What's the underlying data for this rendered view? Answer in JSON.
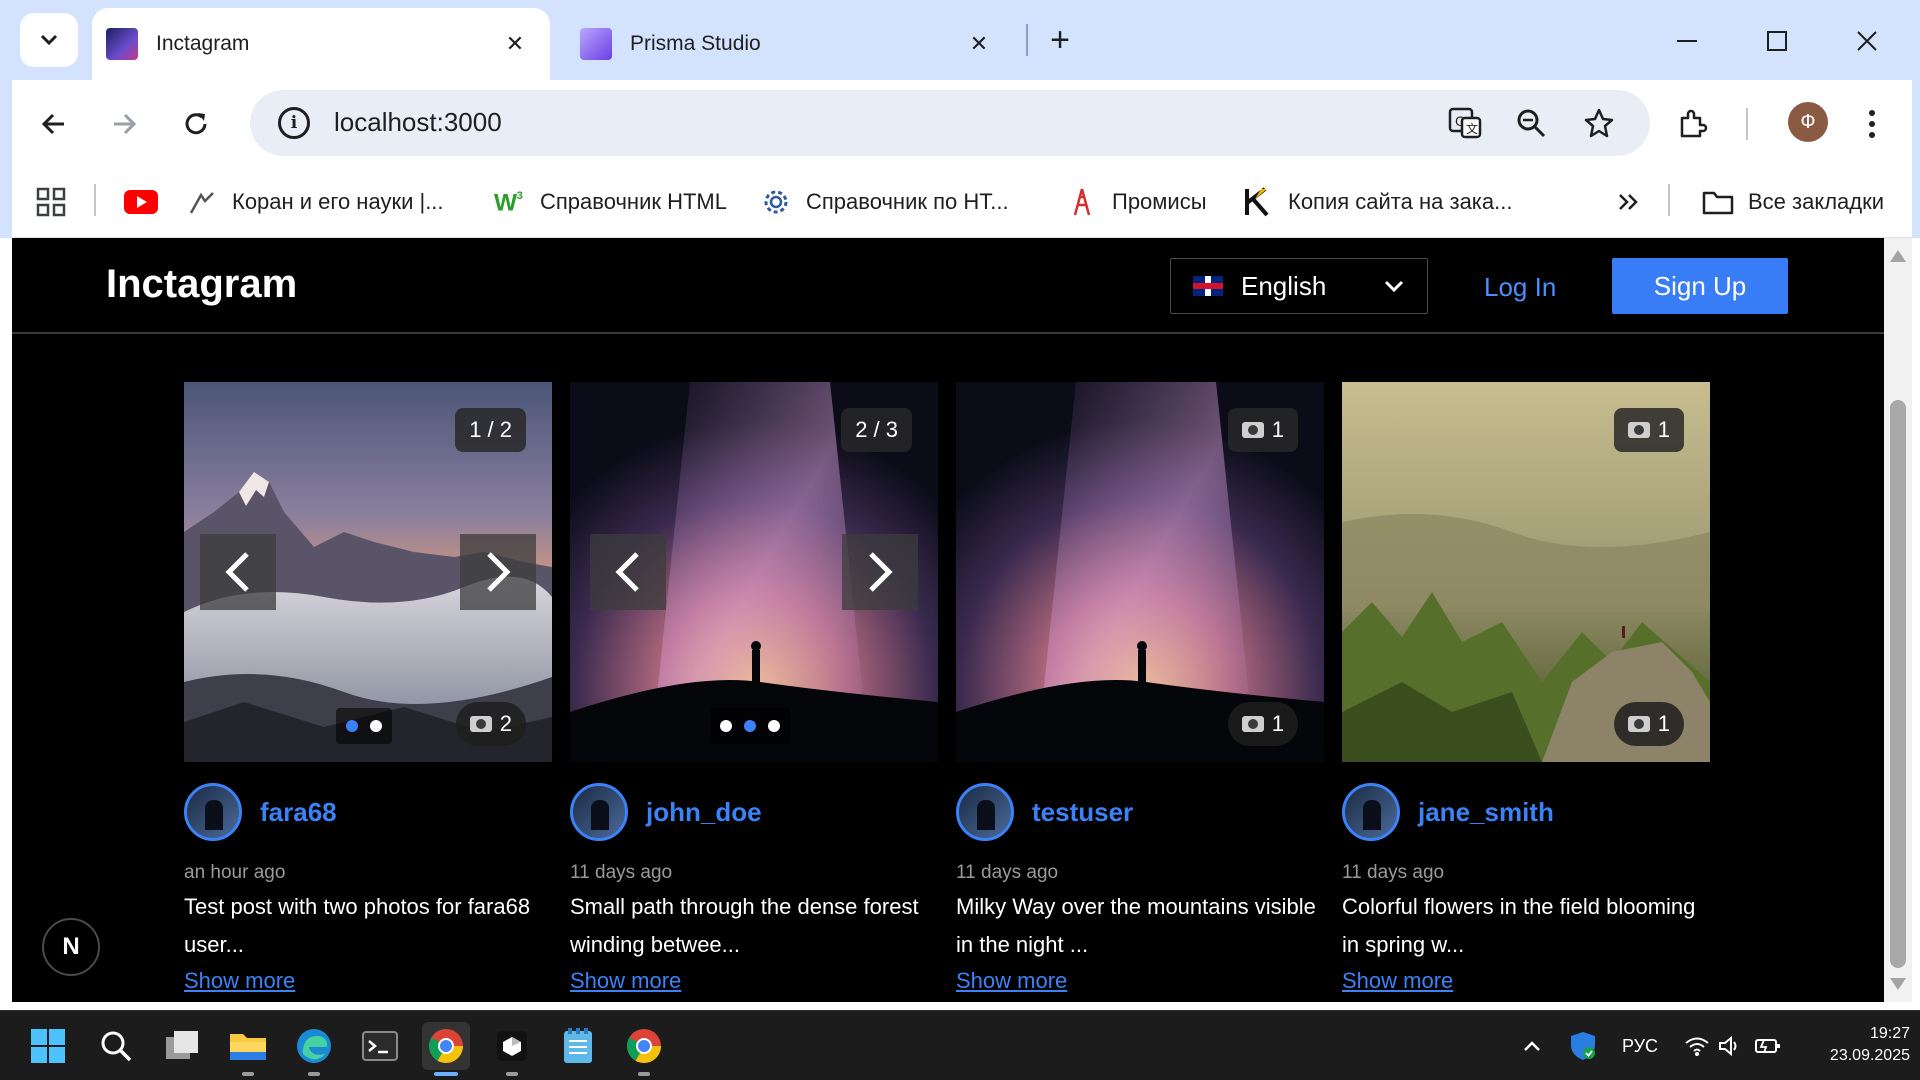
{
  "browser": {
    "tabs": [
      {
        "title": "Inctagram",
        "active": true
      },
      {
        "title": "Prisma Studio",
        "active": false
      }
    ],
    "address": "localhost:3000",
    "profile_initial": "Ф",
    "bookmarks": [
      {
        "label": "Коран и его науки |...",
        "icon": "quran-icon"
      },
      {
        "label": "Справочник HTML",
        "icon": "w3-icon"
      },
      {
        "label": "Справочник по HT...",
        "icon": "gear-icon"
      },
      {
        "label": "Промисы",
        "icon": "tower-icon"
      },
      {
        "label": "Копия сайта на зака...",
        "icon": "k-icon"
      }
    ],
    "all_bookmarks_label": "Все закладки"
  },
  "site": {
    "logo": "Inctagram",
    "language": {
      "label": "English",
      "flag": "uk-flag-icon"
    },
    "login_label": "Log In",
    "signup_label": "Sign Up",
    "accent_color": "#397df6",
    "next_badge": "N"
  },
  "posts": [
    {
      "author": "fara68",
      "time": "an hour ago",
      "description": "Test post with two photos for fara68 user...",
      "show_more": "Show more",
      "counter": "1 / 2",
      "photo_count": "2",
      "dots": 2,
      "active_dot": 0,
      "has_prev": true,
      "has_next": true
    },
    {
      "author": "john_doe",
      "time": "11 days ago",
      "description": "Small path through the dense forest winding betwee...",
      "show_more": "Show more",
      "counter": "2 / 3",
      "photo_count": "",
      "dots": 3,
      "active_dot": 1,
      "has_prev": true,
      "has_next": true
    },
    {
      "author": "testuser",
      "time": "11 days ago",
      "description": "Milky Way over the mountains visible in the night ...",
      "show_more": "Show more",
      "counter": "1",
      "photo_count": "1",
      "dots": 0,
      "active_dot": 0,
      "has_prev": false,
      "has_next": false
    },
    {
      "author": "jane_smith",
      "time": "11 days ago",
      "description": "Colorful flowers in the field blooming in spring w...",
      "show_more": "Show more",
      "counter": "1",
      "photo_count": "1",
      "dots": 0,
      "active_dot": 0,
      "has_prev": false,
      "has_next": false
    }
  ],
  "taskbar": {
    "language": "РУС",
    "time": "19:27",
    "date": "23.09.2025"
  }
}
